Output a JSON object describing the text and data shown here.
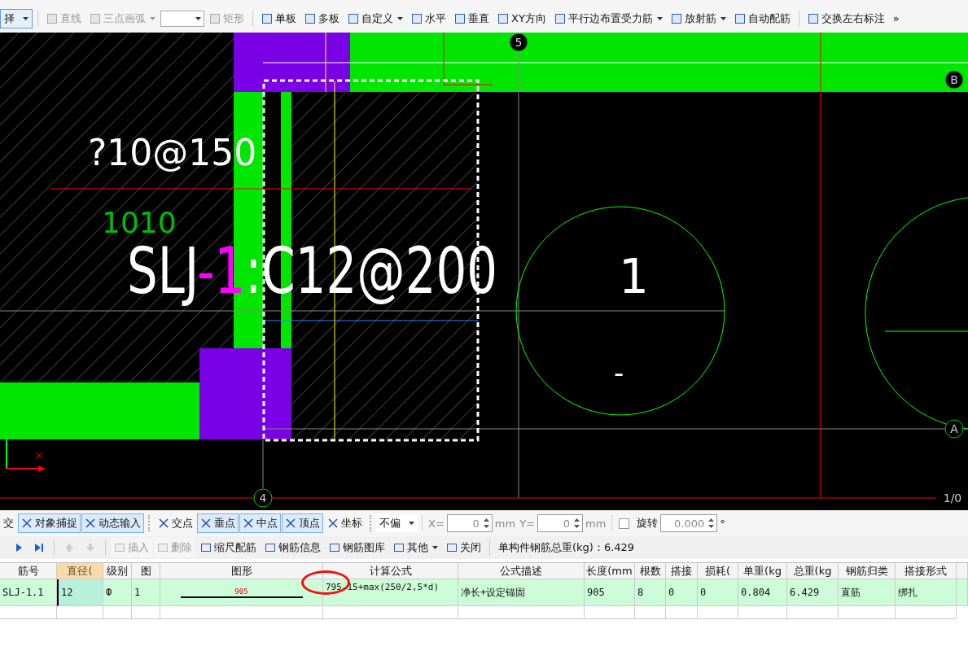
{
  "toolbar": [
    {
      "kind": "dropdown",
      "label": "择",
      "selected": true,
      "disabled": false
    },
    {
      "kind": "separator"
    },
    {
      "kind": "button",
      "label": "直线",
      "disabled": true
    },
    {
      "kind": "dropdown",
      "label": "三点画弧",
      "disabled": true
    },
    {
      "kind": "combo"
    },
    {
      "kind": "button",
      "label": "矩形",
      "disabled": true
    },
    {
      "kind": "separator"
    },
    {
      "kind": "button",
      "label": "单板",
      "disabled": false
    },
    {
      "kind": "button",
      "label": "多板",
      "disabled": false
    },
    {
      "kind": "dropdown",
      "label": "自定义",
      "disabled": false
    },
    {
      "kind": "button",
      "label": "水平",
      "disabled": false
    },
    {
      "kind": "button",
      "label": "垂直",
      "disabled": false
    },
    {
      "kind": "button",
      "label": "XY方向",
      "disabled": false
    },
    {
      "kind": "dropdown",
      "label": "平行边布置受力筋",
      "disabled": false
    },
    {
      "kind": "dropdown",
      "label": "放射筋",
      "disabled": false
    },
    {
      "kind": "button",
      "label": "自动配筋",
      "disabled": false
    },
    {
      "kind": "separator"
    },
    {
      "kind": "button",
      "label": "交换左右标注",
      "disabled": false
    },
    {
      "kind": "overflow",
      "label": "»"
    }
  ],
  "canvas": {
    "axis_labels": [
      {
        "text": "5",
        "kind": "circle"
      },
      {
        "text": "B",
        "kind": "circle"
      },
      {
        "text": "A",
        "kind": "circle"
      },
      {
        "text": "4",
        "kind": "circle"
      },
      {
        "text": "1/0",
        "kind": "plain"
      }
    ],
    "rebar_label": "?10@150",
    "slab_label": [
      {
        "text": "SLJ",
        "highlight": false
      },
      {
        "text": "-1",
        "highlight": true
      },
      {
        "text": ":C12@200",
        "highlight": false
      }
    ],
    "dimension_label": "1010",
    "count_label": "1",
    "dash_mark": "-"
  },
  "snap_bar": {
    "items": [
      {
        "kind": "toggle",
        "label": "交",
        "selected": false
      },
      {
        "kind": "toggle",
        "label": "对象捕捉",
        "selected": true
      },
      {
        "kind": "toggle",
        "label": "动态输入",
        "selected": true
      },
      {
        "kind": "separator"
      },
      {
        "kind": "toggle",
        "label": "交点",
        "selected": false
      },
      {
        "kind": "toggle",
        "label": "垂点",
        "selected": true
      },
      {
        "kind": "toggle",
        "label": "中点",
        "selected": true
      },
      {
        "kind": "toggle",
        "label": "顶点",
        "selected": true
      },
      {
        "kind": "toggle",
        "label": "坐标",
        "selected": false
      }
    ],
    "offset_mode": "不偏",
    "x_label": "X=",
    "x_value": "0",
    "x_unit": "mm",
    "y_label": "Y=",
    "y_value": "0",
    "y_unit": "mm",
    "rotate": {
      "label": "旋转",
      "checked": false,
      "value": "0.000",
      "unit": "°"
    }
  },
  "rebar_toolbar": {
    "items": [
      {
        "kind": "nav",
        "disabled": false
      },
      {
        "kind": "nav-last",
        "disabled": false
      },
      {
        "kind": "separator"
      },
      {
        "kind": "up",
        "disabled": true
      },
      {
        "kind": "down",
        "disabled": true
      },
      {
        "kind": "separator"
      },
      {
        "kind": "button",
        "label": "插入",
        "disabled": true
      },
      {
        "kind": "button",
        "label": "删除",
        "disabled": true
      },
      {
        "kind": "button",
        "label": "缩尺配筋",
        "disabled": false
      },
      {
        "kind": "button",
        "label": "钢筋信息",
        "disabled": false
      },
      {
        "kind": "button",
        "label": "钢筋图库",
        "disabled": false
      },
      {
        "kind": "dropdown",
        "label": "其他",
        "disabled": false
      },
      {
        "kind": "button",
        "label": "关闭",
        "disabled": false
      },
      {
        "kind": "separator"
      }
    ],
    "total_weight": "单构件钢筋总重(kg)：6.429"
  },
  "table": {
    "columns": [
      {
        "label": "筋号",
        "selected": false
      },
      {
        "label": "直径(",
        "selected": true
      },
      {
        "label": "级别",
        "selected": false
      },
      {
        "label": "图",
        "selected": false
      },
      {
        "label": "图形",
        "selected": false
      },
      {
        "label": "计算公式",
        "selected": false
      },
      {
        "label": "公式描述",
        "selected": false
      },
      {
        "label": "长度(mm",
        "selected": false
      },
      {
        "label": "根数",
        "selected": false
      },
      {
        "label": "搭接",
        "selected": false
      },
      {
        "label": "损耗(",
        "selected": false
      },
      {
        "label": "单重(kg",
        "selected": false
      },
      {
        "label": "总重(kg",
        "selected": false
      },
      {
        "label": "钢筋归类",
        "selected": false
      },
      {
        "label": "搭接形式",
        "selected": false
      }
    ],
    "rows": [
      {
        "cells": [
          "SLJ-1.1",
          "12",
          "Ф",
          "1",
          "905",
          "795-15+max(250/2,5*d)",
          "净长+设定锚固",
          "905",
          "8",
          "0",
          "0",
          "0.804",
          "6.429",
          "直筋",
          "绑扎"
        ]
      }
    ]
  }
}
